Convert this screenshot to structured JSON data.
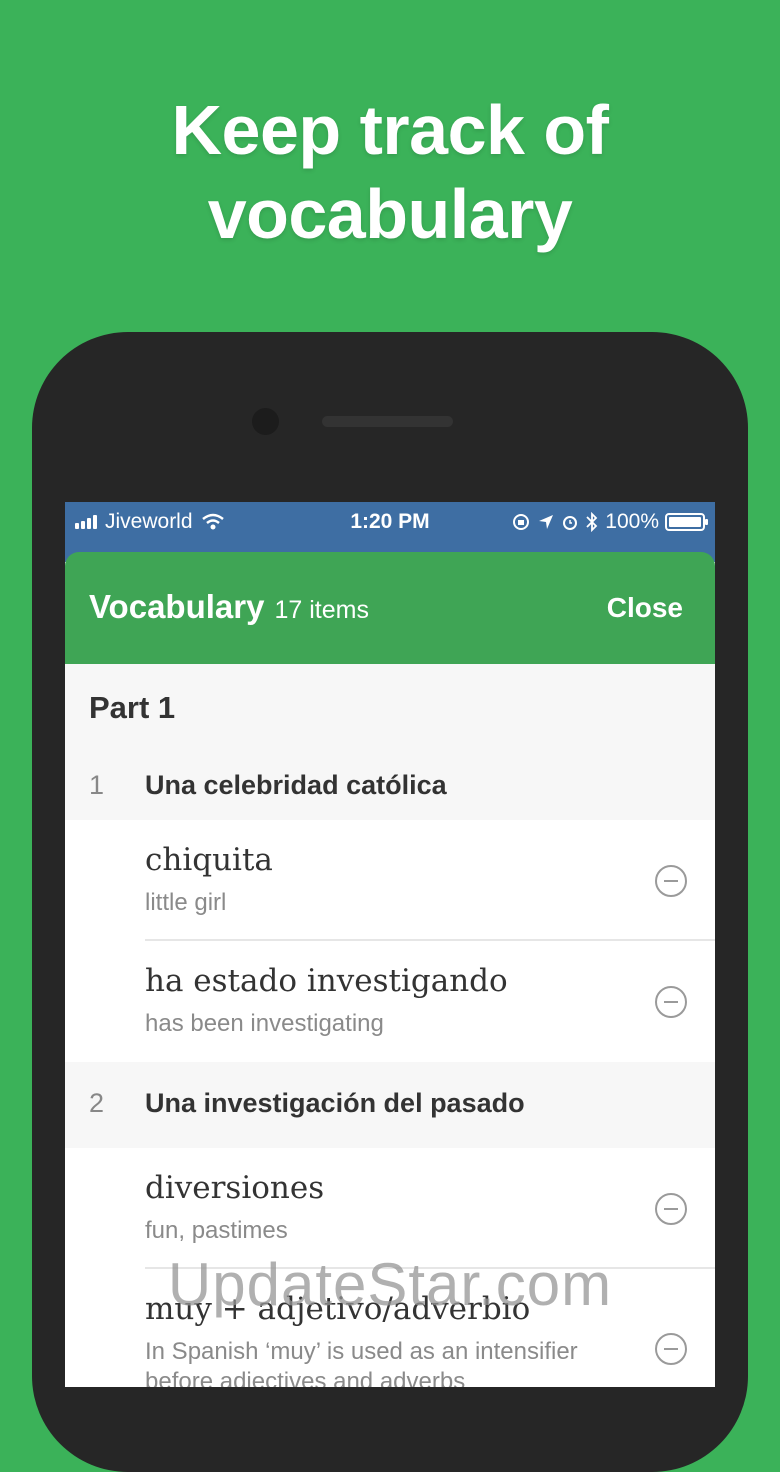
{
  "headline": {
    "line1": "Keep track of",
    "line2": "vocabulary"
  },
  "status_bar": {
    "carrier": "Jiveworld",
    "time": "1:20 PM",
    "battery": "100%"
  },
  "sheet": {
    "title": "Vocabulary",
    "count": "17 items",
    "close_label": "Close"
  },
  "part": {
    "label": "Part 1"
  },
  "chapters": [
    {
      "number": "1",
      "title": "Una celebridad católica",
      "items": [
        {
          "word": "chiquita",
          "gloss": "little girl"
        },
        {
          "word": "ha estado investigando",
          "gloss": "has been investigating"
        }
      ]
    },
    {
      "number": "2",
      "title": "Una investigación del pasado",
      "items": [
        {
          "word": "diversiones",
          "gloss": "fun, pastimes"
        },
        {
          "word": "muy + adjetivo/adverbio",
          "gloss": "In Spanish ‘muy’ is used as an intensifier before adjectives and adverbs"
        }
      ]
    }
  ],
  "watermark": "UpdateStar.com",
  "colors": {
    "background": "#3bb259",
    "header": "#3fa555",
    "status_bar": "#3e6ea3"
  }
}
